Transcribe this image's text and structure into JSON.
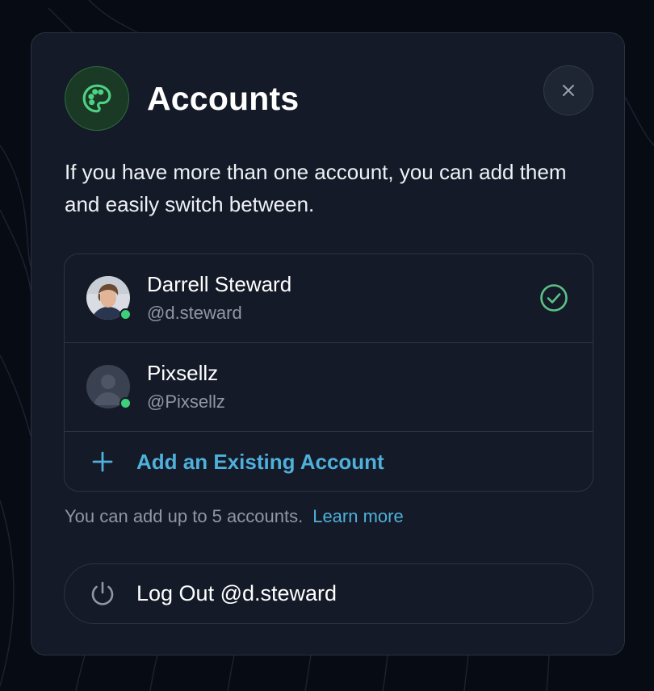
{
  "modal": {
    "title": "Accounts",
    "description": "If you have more than one account, you can add them and easily switch between.",
    "icon": "palette-icon",
    "accent_color": "#3fcf7a"
  },
  "accounts": [
    {
      "name": "Darrell Steward",
      "handle": "@d.steward",
      "status": "online",
      "selected": true
    },
    {
      "name": "Pixsellz",
      "handle": "@Pixsellz",
      "status": "online",
      "selected": false
    }
  ],
  "add_account": {
    "label": "Add an Existing Account",
    "icon": "plus-icon"
  },
  "limit_note": {
    "text": "You can add up to 5 accounts.",
    "link": "Learn more"
  },
  "logout": {
    "label": "Log Out @d.steward",
    "icon": "power-icon"
  },
  "colors": {
    "link": "#4fb0db",
    "online": "#3fcf7a",
    "check": "#5ac287"
  }
}
